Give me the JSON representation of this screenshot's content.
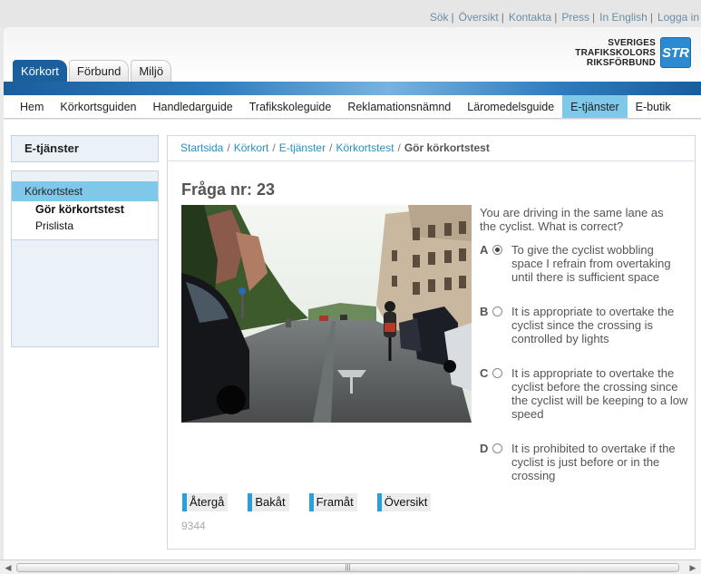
{
  "toplinks": [
    "Sök",
    "Översikt",
    "Kontakta",
    "Press",
    "In English",
    "Logga in"
  ],
  "tabs": [
    {
      "label": "Körkort",
      "active": true
    },
    {
      "label": "Förbund",
      "active": false
    },
    {
      "label": "Miljö",
      "active": false
    }
  ],
  "logo": {
    "line1": "SVERIGES",
    "line2": "TRAFIKSKOLORS",
    "line3": "RIKSFÖRBUND",
    "mark": "STR"
  },
  "mainnav": [
    "Hem",
    "Körkortsguiden",
    "Handledarguide",
    "Trafikskoleguide",
    "Reklamationsnämnd",
    "Läromedelsguide",
    "E-tjänster",
    "E-butik"
  ],
  "mainnav_active": "E-tjänster",
  "sidebar": {
    "heading": "E-tjänster",
    "item": "Körkortstest",
    "subitems": [
      "Gör körkortstest",
      "Prislista"
    ]
  },
  "breadcrumb": [
    "Startsida",
    "Körkort",
    "E-tjänster",
    "Körkortstest"
  ],
  "breadcrumb_current": "Gör körkortstest",
  "question": {
    "title": "Fråga nr: 23",
    "text": "You are driving in the same lane as the cyclist. What is correct?",
    "options": [
      {
        "letter": "A",
        "text": "To give the cyclist wobbling space I refrain from overtaking until there is sufficient space",
        "selected": true
      },
      {
        "letter": "B",
        "text": "It is appropriate to overtake the cyclist since the crossing is controlled by lights",
        "selected": false
      },
      {
        "letter": "C",
        "text": "It is appropriate to overtake the cyclist before the crossing since the cyclist will be keeping to a low speed",
        "selected": false
      },
      {
        "letter": "D",
        "text": "It is prohibited to overtake if the cyclist is just before or in the crossing",
        "selected": false
      }
    ]
  },
  "buttons": [
    "Återgå",
    "Bakåt",
    "Framåt",
    "Översikt"
  ],
  "code": "9344",
  "colors": {
    "brand_blue": "#1a5f9e",
    "accent_cyan": "#7fc8ea",
    "link": "#2b8fc0"
  }
}
